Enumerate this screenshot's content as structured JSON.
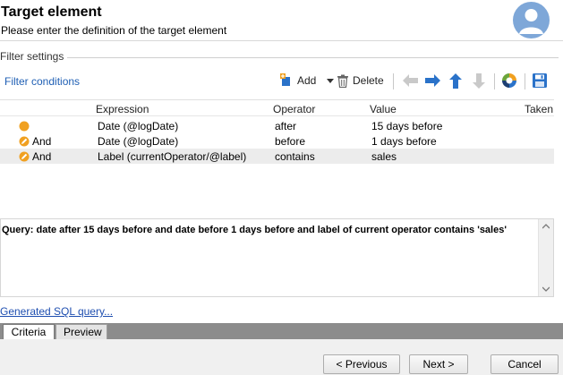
{
  "header": {
    "title": "Target element",
    "subtitle": "Please enter the definition of the target element",
    "avatar_icon": "user-avatar-icon",
    "accent": "#7ea7d8"
  },
  "filter_settings": {
    "group_label": "Filter settings",
    "conditions_label": "Filter conditions",
    "toolbar": {
      "add_label": "Add",
      "delete_label": "Delete",
      "icons": [
        "add-condition-icon",
        "dropdown-arrow-icon",
        "trash-icon",
        "arrow-left-icon",
        "arrow-right-icon",
        "arrow-up-icon",
        "arrow-down-icon",
        "distribution-icon",
        "save-icon"
      ]
    }
  },
  "grid": {
    "columns": [
      "Expression",
      "Operator",
      "Value",
      "Taken"
    ],
    "rows": [
      {
        "conjunction": "",
        "icon": "condition-dot-icon",
        "expression": "Date (@logDate)",
        "operator": "after",
        "value": "15 days before"
      },
      {
        "conjunction": "And",
        "icon": "condition-edit-icon",
        "expression": "Date (@logDate)",
        "operator": "before",
        "value": "1 days before"
      },
      {
        "conjunction": "And",
        "icon": "condition-edit-icon",
        "expression": "Label (currentOperator/@label)",
        "operator": "contains",
        "value": "sales"
      }
    ]
  },
  "query": {
    "text": "Query: date after 15 days before and date before 1 days before and label of current operator contains 'sales'"
  },
  "links": {
    "sql": "Generated SQL query..."
  },
  "tabs": {
    "criteria": "Criteria",
    "preview": "Preview"
  },
  "footer": {
    "previous": "< Previous",
    "next": "Next >",
    "cancel": "Cancel"
  }
}
